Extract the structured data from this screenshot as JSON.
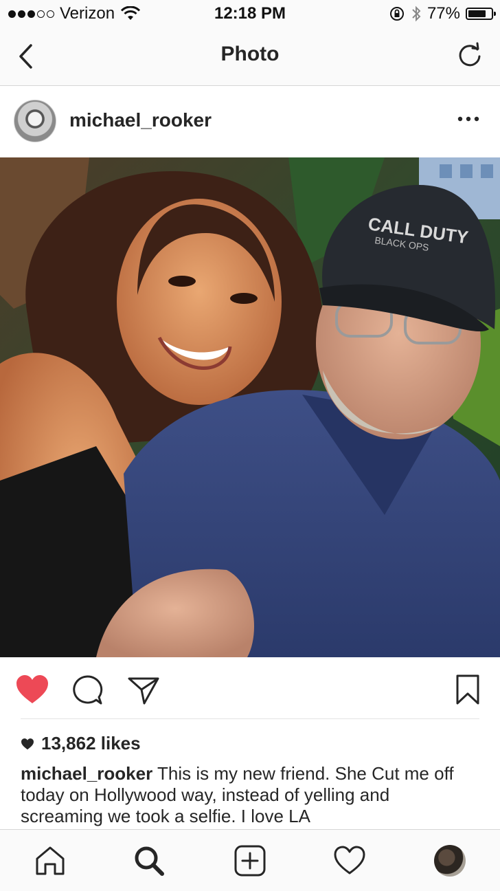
{
  "status_bar": {
    "carrier": "Verizon",
    "time": "12:18 PM",
    "battery": "77%",
    "battery_level": 0.77
  },
  "nav": {
    "title": "Photo",
    "back_icon": "chevron-left-icon",
    "refresh_icon": "refresh-icon"
  },
  "post": {
    "username": "michael_rooker",
    "likes": "13,862 likes",
    "caption_user": "michael_rooker",
    "caption_text": " This is my new friend. She Cut me off today on Hollywood way, instead of yelling and screaming we took a selfie. I love LA",
    "liked": true
  },
  "photo_text": {
    "cap_line1": "CALL DUTY",
    "cap_line2": "BLACK OPS"
  },
  "colors": {
    "like_red": "#ed4956",
    "text": "#262626"
  },
  "tabs": [
    "home-icon",
    "search-icon",
    "add-post-icon",
    "activity-heart-icon",
    "profile-avatar"
  ]
}
